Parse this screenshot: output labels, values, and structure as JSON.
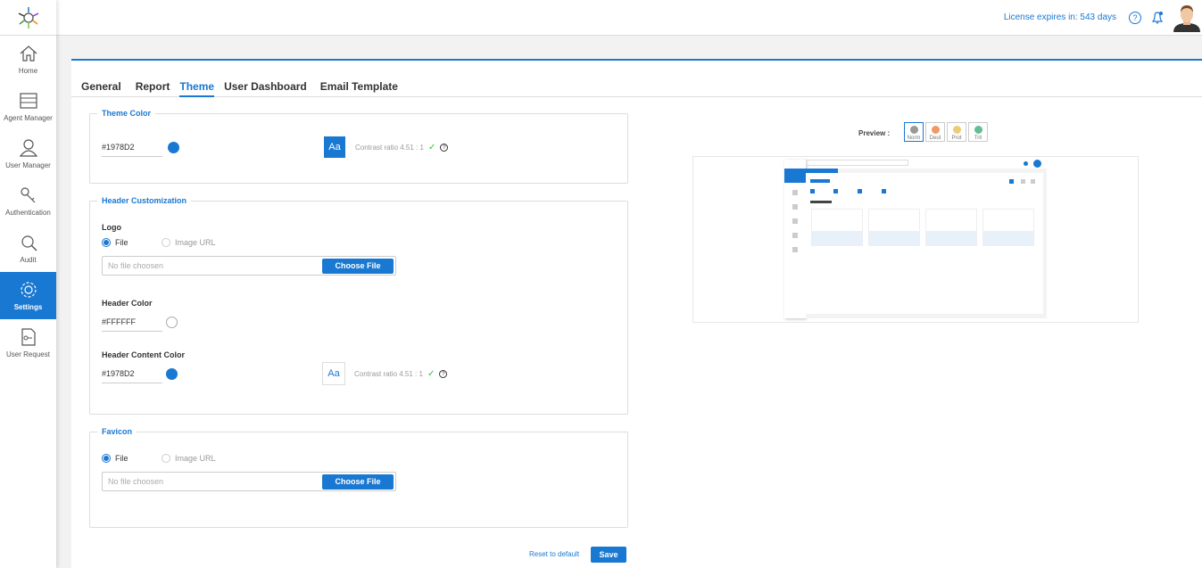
{
  "header": {
    "license_text": "License expires in: 543 days",
    "help_icon": "help-circle-icon",
    "bell_icon": "bell-icon"
  },
  "sidebar": {
    "items": [
      {
        "label": "Home",
        "icon": "home-icon"
      },
      {
        "label": "Agent Manager",
        "icon": "server-icon"
      },
      {
        "label": "User Manager",
        "icon": "user-icon"
      },
      {
        "label": "Authentication",
        "icon": "keys-icon"
      },
      {
        "label": "Audit",
        "icon": "audit-icon"
      },
      {
        "label": "Settings",
        "icon": "gear-icon",
        "active": true
      },
      {
        "label": "User Request",
        "icon": "document-key-icon"
      }
    ]
  },
  "tabs": [
    "General",
    "Report",
    "Theme",
    "User Dashboard",
    "Email Template"
  ],
  "active_tab": "Theme",
  "theme_color": {
    "legend": "Theme Color",
    "value": "#1978D2",
    "aa": "Aa",
    "contrast": "Contrast ratio 4.51 : 1",
    "check": "✓",
    "help": "?"
  },
  "header_custom": {
    "legend": "Header Customization",
    "logo_label": "Logo",
    "file_option": "File",
    "url_option": "Image URL",
    "file_placeholder": "No file choosen",
    "choose_label": "Choose File",
    "header_color_label": "Header Color",
    "header_color": "#FFFFFF",
    "content_color_label": "Header Content Color",
    "content_color": "#1978D2",
    "aa": "Aa",
    "contrast": "Contrast ratio 4.51 : 1",
    "check": "✓",
    "help": "?"
  },
  "favicon": {
    "legend": "Favicon",
    "file_option": "File",
    "url_option": "Image URL",
    "file_placeholder": "No file choosen",
    "choose_label": "Choose File"
  },
  "actions": {
    "reset": "Reset to default",
    "save": "Save"
  },
  "preview": {
    "label": "Preview :",
    "options": [
      "Norm",
      "Deut",
      "Prot",
      "Trit"
    ],
    "selected": "Norm"
  },
  "colors": {
    "accent": "#1978d2"
  }
}
